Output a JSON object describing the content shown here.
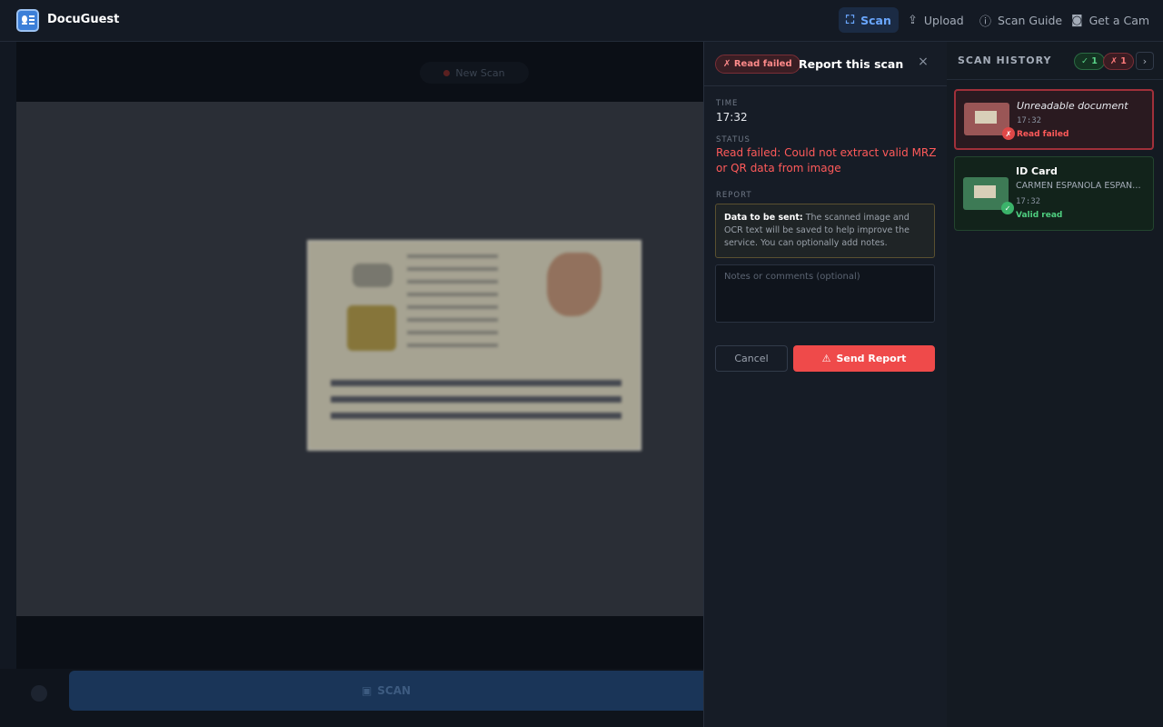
{
  "app": {
    "name": "DocuGuest"
  },
  "nav": [
    {
      "label": "Scan",
      "icon": "scan-frame-icon",
      "active": true
    },
    {
      "label": "Upload",
      "icon": "upload-icon",
      "active": false
    },
    {
      "label": "Scan Guide",
      "icon": "help-circle-icon",
      "active": false
    },
    {
      "label": "Get a Cam",
      "icon": "camera-icon",
      "active": false
    }
  ],
  "camera": {
    "status_pill": "New Scan",
    "scan_button": "SCAN"
  },
  "report": {
    "badge": "✗ Read failed",
    "title": "Report this scan",
    "close": "×",
    "time_label": "TIME",
    "time": "17:32",
    "status_label": "STATUS",
    "status": "Read failed: Could not extract valid MRZ or QR data from image",
    "report_label": "REPORT",
    "notice_strong": "Data to be sent:",
    "notice_text": " The scanned image and OCR text will be saved to help improve the service. You can optionally add notes.",
    "notes_placeholder": "Notes or comments (optional)",
    "cancel": "Cancel",
    "send": "Send Report"
  },
  "history": {
    "title": "SCAN HISTORY",
    "ok_count": "✓ 1",
    "fail_count": "✗ 1",
    "next": "›",
    "items": [
      {
        "title": "Unreadable document",
        "time": "17:32",
        "state": "Read failed",
        "status": "fail"
      },
      {
        "title": "ID Card",
        "subtitle": "CARMEN ESPANOLA ESPANOLA",
        "time": "17:32",
        "state": "Valid read",
        "status": "ok"
      }
    ]
  },
  "colors": {
    "accent": "#6aa7ff",
    "danger": "#ef4a4a",
    "success": "#4fcf80"
  }
}
